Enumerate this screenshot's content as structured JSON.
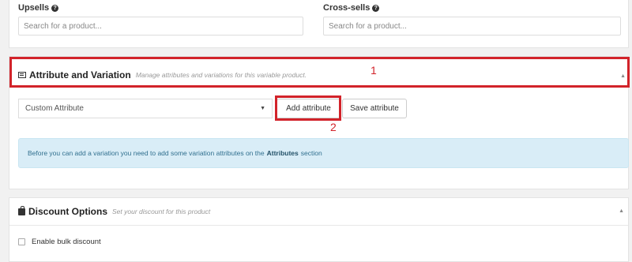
{
  "upsells": {
    "label": "Upsells",
    "placeholder": "Search for a product..."
  },
  "cross_sells": {
    "label": "Cross-sells",
    "placeholder": "Search for a product..."
  },
  "attribute_section": {
    "title": "Attribute and Variation",
    "description": "Manage attributes and variations for this variable product.",
    "select_value": "Custom Attribute",
    "add_button": "Add attribute",
    "save_button": "Save attribute",
    "info_prefix": "Before you can add a variation you need to add some variation attributes on the",
    "info_link": "Attributes",
    "info_suffix": "section"
  },
  "discount_section": {
    "title": "Discount Options",
    "description": "Set your discount for this product",
    "checkbox_label": "Enable bulk discount"
  },
  "annotations": {
    "first": "1",
    "second": "2"
  },
  "colors": {
    "highlight": "#d2232a",
    "info_bg": "#d9edf7",
    "info_text": "#31708f"
  }
}
